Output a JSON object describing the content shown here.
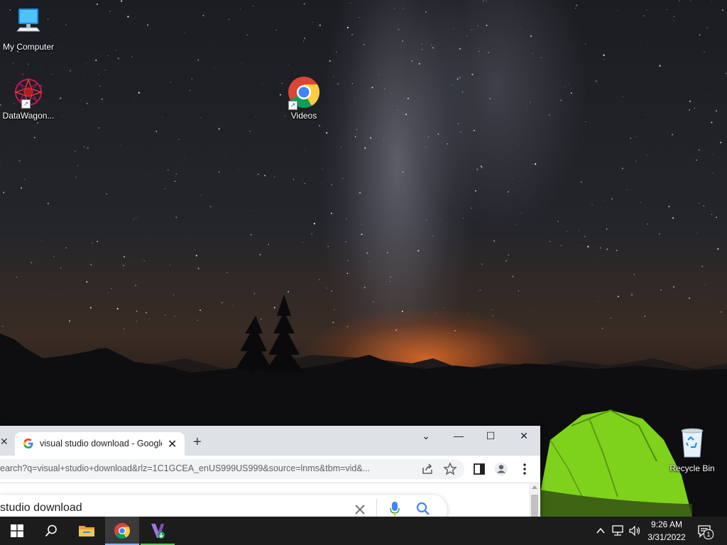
{
  "desktop": {
    "icons": [
      {
        "label": "My Computer",
        "icon": "computer-icon"
      },
      {
        "label": "DataWagon...",
        "icon": "datawagon-icon"
      },
      {
        "label": "Videos",
        "icon": "chrome-icon"
      },
      {
        "label": "Recycle Bin",
        "icon": "recycle-bin-icon"
      }
    ]
  },
  "browser": {
    "tab_title": "visual studio download - Google",
    "new_tab_symbol": "+",
    "close_symbol": "✕",
    "prev_tab_close": "✕",
    "url": "earch?q=visual+studio+download&rlz=1C1GCEA_enUS999US999&source=lnms&tbm=vid&...",
    "search_query": "studio download",
    "window_controls": {
      "dropdown": "⌄",
      "minimize": "—",
      "maximize": "☐",
      "close": "✕"
    }
  },
  "taskbar": {
    "apps": [
      {
        "name": "start-button",
        "icon": "windows-icon"
      },
      {
        "name": "search-button",
        "icon": "search-icon"
      },
      {
        "name": "file-explorer",
        "icon": "folder-icon"
      },
      {
        "name": "chrome",
        "icon": "chrome-icon",
        "active": true
      },
      {
        "name": "visual-studio-installer",
        "icon": "vs-installer-icon"
      }
    ],
    "clock": {
      "time": "9:26 AM",
      "date": "3/31/2022"
    },
    "notification_count": "1"
  },
  "colors": {
    "taskbar": "#1c1c1c",
    "chrome_tabstrip": "#dee1e6",
    "tent_green": "#7fd21c"
  }
}
